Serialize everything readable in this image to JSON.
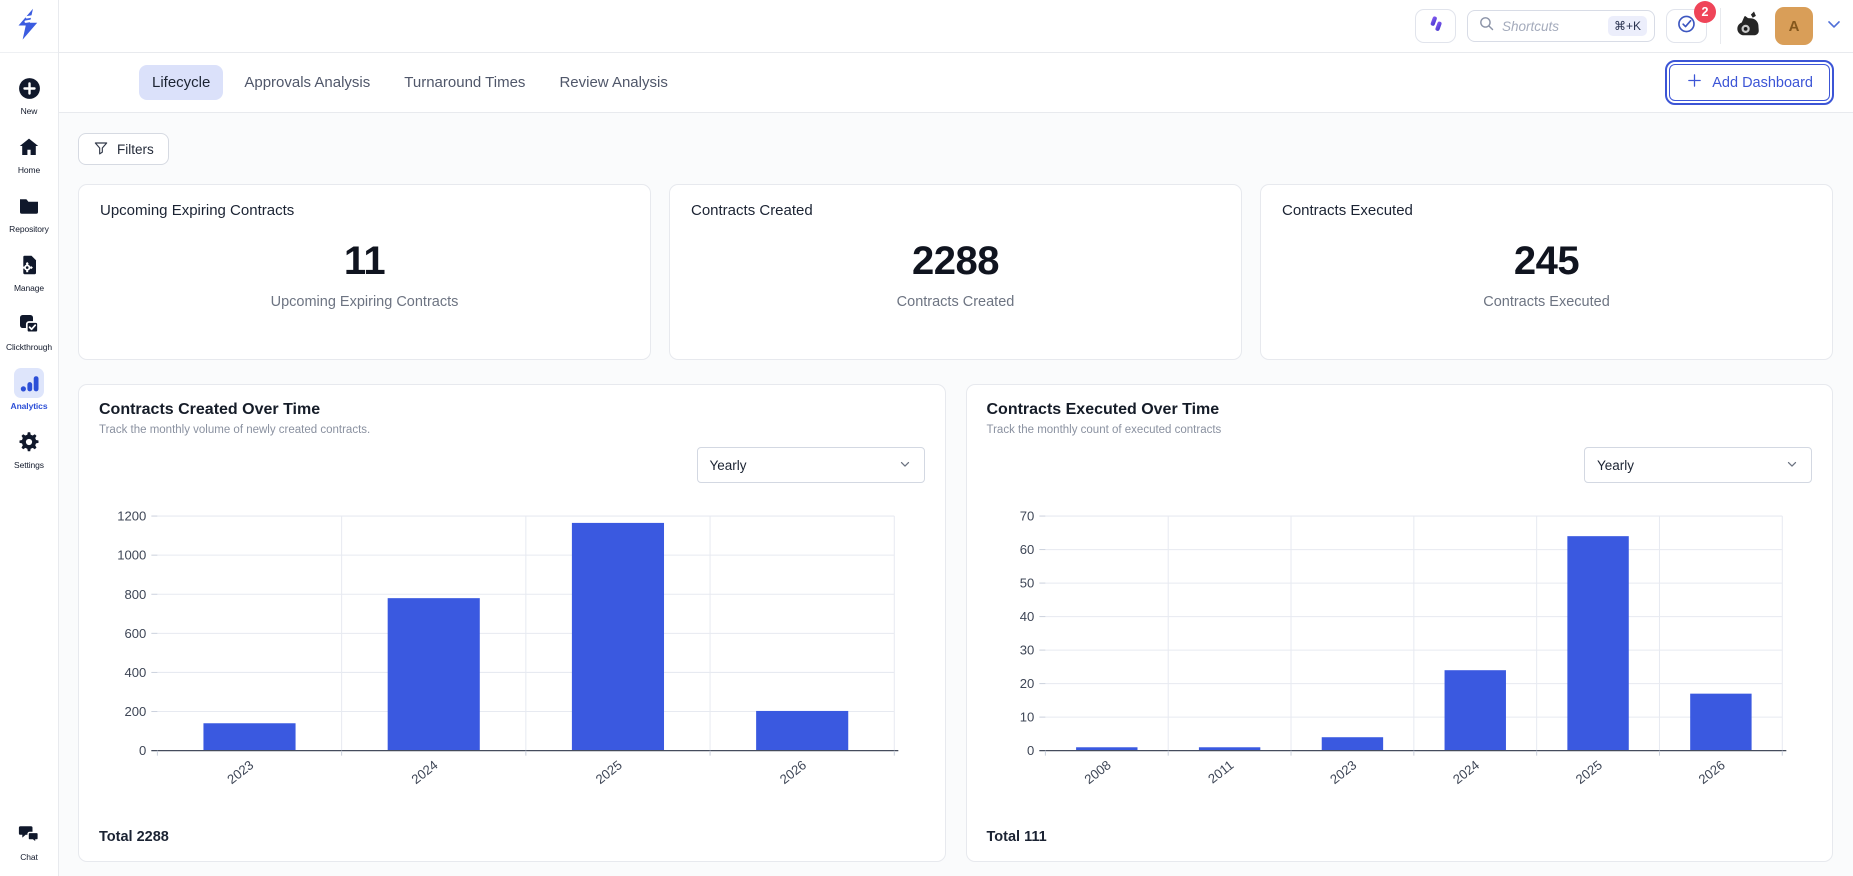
{
  "colors": {
    "accent": "#3C55D6",
    "bar": "#3A59E0",
    "active_tab_bg": "#DBE1FA",
    "badge_red": "#EF4458",
    "avatar_bg": "#D99E58",
    "grid_line": "#E7EAF1",
    "axis_line": "#454C5C",
    "axis_text": "#3E4656"
  },
  "sidebar": {
    "items": [
      {
        "label": "New",
        "icon": "plus-circle-icon"
      },
      {
        "label": "Home",
        "icon": "home-icon"
      },
      {
        "label": "Repository",
        "icon": "folder-icon"
      },
      {
        "label": "Manage",
        "icon": "document-gear-icon"
      },
      {
        "label": "Clickthrough",
        "icon": "clickthrough-check-icon"
      },
      {
        "label": "Analytics",
        "icon": "bar-chart-icon",
        "active": true
      },
      {
        "label": "Settings",
        "icon": "gear-icon"
      }
    ],
    "bottom_item": {
      "label": "Chat",
      "icon": "chat-icon"
    }
  },
  "topbar": {
    "search": {
      "placeholder": "Shortcuts",
      "shortcut": "⌘+K"
    },
    "tasks_badge_count": "2",
    "avatar_initial": "A"
  },
  "tabs": [
    {
      "label": "Lifecycle",
      "active": true
    },
    {
      "label": "Approvals Analysis",
      "active": false
    },
    {
      "label": "Turnaround Times",
      "active": false
    },
    {
      "label": "Review Analysis",
      "active": false
    }
  ],
  "add_dashboard_label": "Add Dashboard",
  "filters_label": "Filters",
  "stat_cards": [
    {
      "title": "Upcoming Expiring Contracts",
      "value": "11",
      "subtitle": "Upcoming Expiring Contracts"
    },
    {
      "title": "Contracts Created",
      "value": "2288",
      "subtitle": "Contracts Created"
    },
    {
      "title": "Contracts Executed",
      "value": "245",
      "subtitle": "Contracts Executed"
    }
  ],
  "chart_data": [
    {
      "type": "bar",
      "title": "Contracts Created Over Time",
      "subtitle": "Track the monthly volume of newly created contracts.",
      "period_selector": "Yearly",
      "categories": [
        "2023",
        "2024",
        "2025",
        "2026"
      ],
      "values": [
        140,
        780,
        1165,
        203
      ],
      "ylim": [
        0,
        1200
      ],
      "yticks": [
        0,
        200,
        400,
        600,
        800,
        1000,
        1200
      ],
      "grid": true,
      "legend": "none",
      "total_label": "Total 2288"
    },
    {
      "type": "bar",
      "title": "Contracts Executed Over Time",
      "subtitle": "Track the monthly count of executed contracts",
      "period_selector": "Yearly",
      "categories": [
        "2008",
        "2011",
        "2023",
        "2024",
        "2025",
        "2026"
      ],
      "values": [
        1,
        1,
        4,
        24,
        64,
        17
      ],
      "ylim": [
        0,
        70
      ],
      "yticks": [
        0,
        10,
        20,
        30,
        40,
        50,
        60,
        70
      ],
      "grid": true,
      "legend": "none",
      "total_label": "Total 111"
    }
  ]
}
